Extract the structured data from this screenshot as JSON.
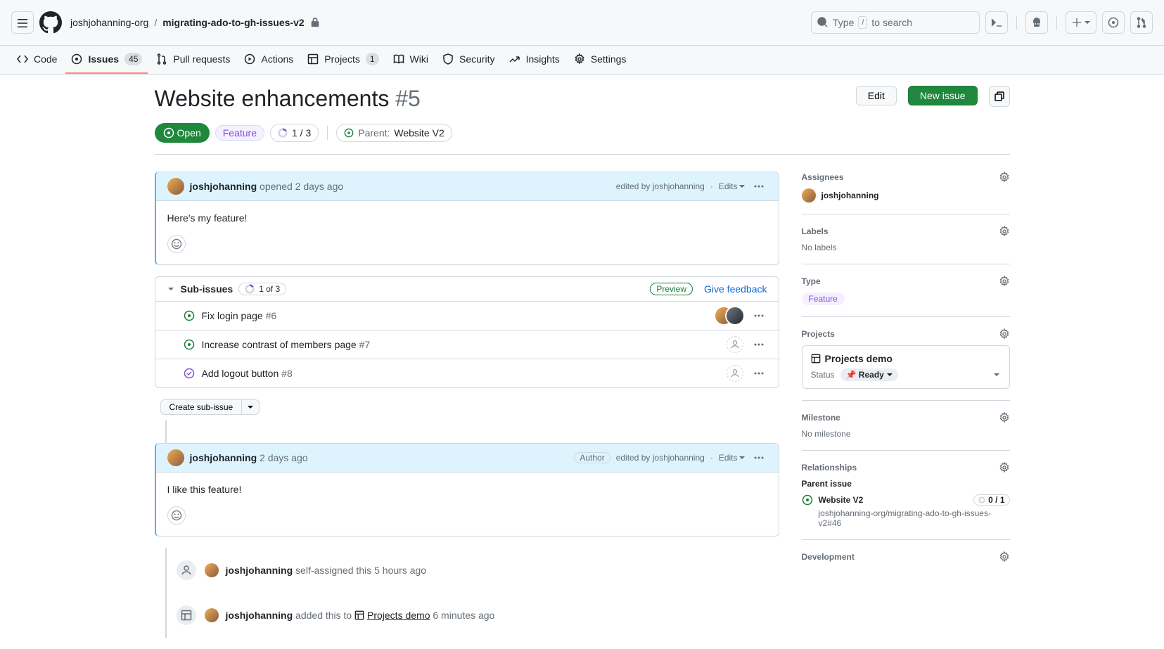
{
  "header": {
    "org": "joshjohanning-org",
    "repo": "migrating-ado-to-gh-issues-v2",
    "search_placeholder": "Type",
    "search_suffix": "to search",
    "search_key": "/"
  },
  "nav": {
    "code": "Code",
    "issues": "Issues",
    "issues_count": "45",
    "pull": "Pull requests",
    "actions": "Actions",
    "projects": "Projects",
    "projects_count": "1",
    "wiki": "Wiki",
    "security": "Security",
    "insights": "Insights",
    "settings": "Settings"
  },
  "issue": {
    "title": "Website enhancements",
    "number": "#5",
    "edit": "Edit",
    "new_issue": "New issue",
    "state": "Open",
    "type_label": "Feature",
    "progress": "1 / 3",
    "parent_label": "Parent:",
    "parent_name": "Website V2"
  },
  "comment1": {
    "author": "joshjohanning",
    "action": "opened 2 days ago",
    "edited": "edited by joshjohanning",
    "edits": "Edits",
    "body": "Here's my feature!"
  },
  "subissues": {
    "title": "Sub-issues",
    "count": "1 of 3",
    "preview": "Preview",
    "feedback": "Give feedback",
    "create": "Create sub-issue",
    "items": [
      {
        "title": "Fix login page",
        "num": "#6",
        "status": "open",
        "assignees": 2
      },
      {
        "title": "Increase contrast of members page",
        "num": "#7",
        "status": "open",
        "assignees": 0
      },
      {
        "title": "Add logout button",
        "num": "#8",
        "status": "closed",
        "assignees": 0
      }
    ]
  },
  "comment2": {
    "author": "joshjohanning",
    "time": "2 days ago",
    "author_badge": "Author",
    "edited": "edited by joshjohanning",
    "edits": "Edits",
    "body": "I like this feature!"
  },
  "events": {
    "assign_author": "joshjohanning",
    "assign_text": "self-assigned this 5 hours ago",
    "project_author": "joshjohanning",
    "project_text_pre": "added this to",
    "project_name": "Projects demo",
    "project_time": "6 minutes ago"
  },
  "sidebar": {
    "assignees_title": "Assignees",
    "assignee_name": "joshjohanning",
    "labels_title": "Labels",
    "labels_empty": "No labels",
    "type_title": "Type",
    "type_value": "Feature",
    "projects_title": "Projects",
    "project_name": "Projects demo",
    "project_status_label": "Status",
    "project_status_value": "📌 Ready",
    "milestone_title": "Milestone",
    "milestone_empty": "No milestone",
    "relationships_title": "Relationships",
    "parent_issue_label": "Parent issue",
    "parent_issue_name": "Website V2",
    "parent_count": "0 / 1",
    "parent_path": "joshjohanning-org/migrating-ado-to-gh-issues-v2#46",
    "development_title": "Development"
  }
}
